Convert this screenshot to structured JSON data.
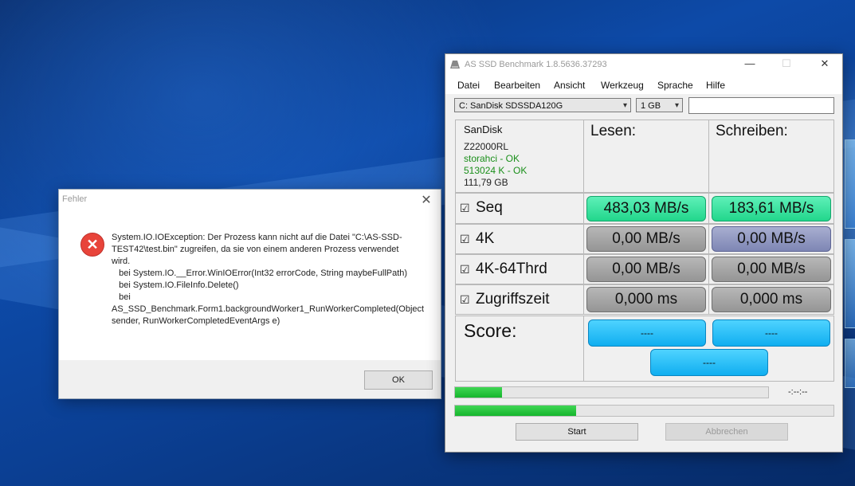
{
  "error_dialog": {
    "title": "Fehler",
    "close_symbol": "✕",
    "icon": "error-icon",
    "message": "System.IO.IOException: Der Prozess kann nicht auf die Datei \"C:\\AS-SSD-TEST42\\test.bin\" zugreifen, da sie von einem anderen Prozess verwendet wird.\n   bei System.IO.__Error.WinIOError(Int32 errorCode, String maybeFullPath)\n   bei System.IO.FileInfo.Delete()\n   bei AS_SSD_Benchmark.Form1.backgroundWorker1_RunWorkerCompleted(Object sender, RunWorkerCompletedEventArgs e)",
    "ok_label": "OK"
  },
  "app": {
    "title": "AS SSD Benchmark 1.8.5636.37293",
    "controls": {
      "minimize": "—",
      "maximize": "☐",
      "close": "✕"
    },
    "menu": [
      "Datei",
      "Bearbeiten",
      "Ansicht",
      "Werkzeug",
      "Sprache",
      "Hilfe"
    ],
    "drive_select": "C: SanDisk SDSSDA120G",
    "size_select": "1 GB",
    "drive_info": {
      "vendor": "SanDisk",
      "firmware": "Z22000RL",
      "driver": "storahci - OK",
      "alignment": "513024 K - OK",
      "capacity": "111,79 GB"
    },
    "headers": {
      "read": "Lesen:",
      "write": "Schreiben:"
    },
    "tests": [
      {
        "check": "☑",
        "label": "Seq",
        "read": "483,03 MB/s",
        "write": "183,61 MB/s"
      },
      {
        "check": "☑",
        "label": "4K",
        "read": "0,00 MB/s",
        "write": "0,00 MB/s"
      },
      {
        "check": "☑",
        "label": "4K-64Thrd",
        "read": "0,00 MB/s",
        "write": "0,00 MB/s"
      },
      {
        "check": "☑",
        "label": "Zugriffszeit",
        "read": "0,000 ms",
        "write": "0,000 ms"
      }
    ],
    "score_label": "Score:",
    "score_read": "----",
    "score_write": "----",
    "score_total": "----",
    "progress_time": "-:--:--",
    "progress1": 0.15,
    "progress2": 0.32,
    "start_label": "Start",
    "abort_label": "Abbrechen",
    "colors": {
      "result_green": "#22d68c",
      "score_blue": "#10aef0",
      "progress_green": "#16b52d"
    }
  }
}
